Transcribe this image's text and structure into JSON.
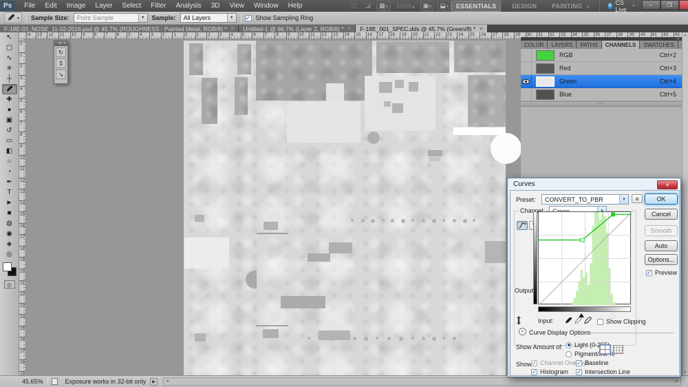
{
  "icons": {
    "close": "✕",
    "dropdown": "▼",
    "small_arrow": "▾",
    "check": "✓",
    "menu": "≡",
    "chevrons": "»",
    "right_arrow": "▶",
    "left_arrow": "◄",
    "up_arrow": "▲",
    "down_arrow": "▼"
  },
  "colors": {
    "selection_blue": "#2e7de8",
    "rgb_thumb_green": "#44d33c",
    "curve_green": "#2ec82e",
    "histogram_green": "#c5eeb1",
    "close_red": "#c93a41"
  },
  "menu_bar": {
    "logo": "Ps",
    "items": [
      "File",
      "Edit",
      "Image",
      "Layer",
      "Select",
      "Filter",
      "Analysis",
      "3D",
      "View",
      "Window",
      "Help"
    ],
    "zoom_display": "100%",
    "workspaces": [
      {
        "label": "ESSENTIALS",
        "active": true
      },
      {
        "label": "DESIGN",
        "active": false
      },
      {
        "label": "PAINTING",
        "active": false
      }
    ],
    "overflow": "»",
    "cs_live": "CS Live"
  },
  "options_bar": {
    "sample_size_label": "Sample Size:",
    "sample_size_value": "Point Sample",
    "sample_label": "Sample:",
    "sample_value": "All Layers",
    "show_sampling_ring_label": "Show Sampling Ring",
    "show_sampling_ring_checked": true
  },
  "document_tabs": [
    {
      "title": "F-18E-01_NOSE_11-02-2016.psd @ 45.7% (ROUGHNESS - Painted Metal, RGB/8) *",
      "active": false
    },
    {
      "title": "Untitled-1 @ 66.7% (Layer 2, RGB/8) *",
      "active": false
    },
    {
      "title": "F-18E_001_SPEC.dds @ 45.7% (Green/8) *",
      "active": true
    }
  ],
  "tool_palette": [
    {
      "name": "move-tool",
      "glyph": "↖",
      "selected": false
    },
    {
      "name": "marquee-tool",
      "glyph": "▢",
      "selected": false
    },
    {
      "name": "lasso-tool",
      "glyph": "∿",
      "selected": false
    },
    {
      "name": "quick-selection-tool",
      "glyph": "✳",
      "selected": false
    },
    {
      "name": "crop-tool",
      "glyph": "┼",
      "selected": false
    },
    {
      "name": "eyedropper-tool",
      "glyph": "dropper",
      "selected": true
    },
    {
      "name": "healing-brush-tool",
      "glyph": "✚",
      "selected": false
    },
    {
      "name": "brush-tool",
      "glyph": "●",
      "selected": false
    },
    {
      "name": "clone-stamp-tool",
      "glyph": "▣",
      "selected": false
    },
    {
      "name": "history-brush-tool",
      "glyph": "↺",
      "selected": false
    },
    {
      "name": "eraser-tool",
      "glyph": "▭",
      "selected": false
    },
    {
      "name": "gradient-tool",
      "glyph": "◧",
      "selected": false
    },
    {
      "name": "blur-tool",
      "glyph": "○",
      "selected": false
    },
    {
      "name": "dodge-tool",
      "glyph": "◔",
      "selected": false
    },
    {
      "name": "pen-tool",
      "glyph": "✒",
      "selected": false
    },
    {
      "name": "type-tool",
      "glyph": "T",
      "selected": false
    },
    {
      "name": "path-selection-tool",
      "glyph": "►",
      "selected": false
    },
    {
      "name": "shape-tool",
      "glyph": "■",
      "selected": false
    },
    {
      "name": "3d-object-rotate-tool",
      "glyph": "◍",
      "selected": false
    },
    {
      "name": "3d-camera-rotate-tool",
      "glyph": "◉",
      "selected": false
    },
    {
      "name": "hand-tool",
      "glyph": "◈",
      "selected": false
    },
    {
      "name": "zoom-tool",
      "glyph": "◎",
      "selected": false
    }
  ],
  "float_panel": {
    "icons": [
      {
        "name": "float-tool-1",
        "glyph": "↻"
      },
      {
        "name": "float-tool-2",
        "glyph": "⇕"
      },
      {
        "name": "float-tool-3",
        "glyph": "↘"
      }
    ]
  },
  "panels": {
    "tabs": [
      {
        "label": "COLOR",
        "active": false
      },
      {
        "label": "LAYERS",
        "active": false
      },
      {
        "label": "PATHS",
        "active": false
      },
      {
        "label": "CHANNELS",
        "active": true
      },
      {
        "label": "SWATCHES",
        "active": false
      },
      {
        "label": "STYLES",
        "active": false
      }
    ],
    "channels": [
      {
        "name": "RGB",
        "shortcut": "Ctrl+2",
        "thumb": "#44d33c",
        "selected": false,
        "eye": false
      },
      {
        "name": "Red",
        "shortcut": "Ctrl+3",
        "thumb": "#585858",
        "selected": false,
        "eye": false
      },
      {
        "name": "Green",
        "shortcut": "Ctrl+4",
        "thumb": "#e9e9e9",
        "selected": true,
        "eye": true
      },
      {
        "name": "Blue",
        "shortcut": "Ctrl+5",
        "thumb": "#515151",
        "selected": false,
        "eye": false
      }
    ]
  },
  "curves_dialog": {
    "title": "Curves",
    "preset_label": "Preset:",
    "preset_value": "CONVERT_TO_PBR",
    "channel_label": "Channel:",
    "channel_value": "Green",
    "ok_label": "OK",
    "cancel_label": "Cancel",
    "smooth_label": "Smooth",
    "auto_label": "Auto",
    "options_label": "Options...",
    "preview_label": "Preview",
    "preview_checked": true,
    "output_label": "Output:",
    "input_label": "Input:",
    "show_clipping_label": "Show Clipping",
    "show_clipping_checked": false,
    "display_options_label": "Curve Display Options",
    "show_amount_label": "Show Amount of:",
    "amount_options": [
      {
        "label": "Light  (0-255)",
        "selected": true
      },
      {
        "label": "Pigment/Ink %",
        "selected": false
      }
    ],
    "show_label": "Show:",
    "show_checkboxes": [
      {
        "label": "Channel Overlays",
        "checked": true,
        "disabled": true,
        "col": 0,
        "row": 0
      },
      {
        "label": "Baseline",
        "checked": true,
        "disabled": false,
        "col": 1,
        "row": 0
      },
      {
        "label": "Histogram",
        "checked": true,
        "disabled": false,
        "col": 0,
        "row": 1
      },
      {
        "label": "Intersection Line",
        "checked": true,
        "disabled": false,
        "col": 1,
        "row": 1
      }
    ],
    "curve": {
      "flat_output_pct": 70,
      "points_pct": [
        [
          0,
          70
        ],
        [
          47,
          70
        ],
        [
          80,
          97.5
        ],
        [
          100,
          97.5
        ]
      ],
      "handles_pct": [
        [
          47,
          70
        ],
        [
          80,
          97.5
        ]
      ],
      "black_input_slider_pct": 47,
      "white_input_slider_pct": 80,
      "input_black_value": 120,
      "input_white_value": 204
    },
    "histogram_bins_pct": [
      0,
      0,
      0,
      0,
      0,
      0,
      0,
      0,
      0,
      0,
      0,
      0,
      0,
      0,
      3,
      8,
      15,
      26,
      38,
      30,
      35,
      22,
      45,
      85,
      100,
      100,
      92,
      100,
      96,
      78,
      40,
      12,
      3,
      0,
      0,
      0,
      0,
      0,
      0,
      0
    ]
  },
  "rulers": {
    "h_numbers": [
      "14",
      "13",
      "12",
      "11",
      "10",
      "9",
      "8",
      "7",
      "6",
      "5",
      "4",
      "3",
      "2",
      "1",
      "0",
      "1",
      "2",
      "3",
      "4",
      "5",
      "6",
      "7",
      "8",
      "9",
      "10",
      "11",
      "12",
      "13",
      "14",
      "15",
      "16",
      "17",
      "18",
      "19",
      "20",
      "21",
      "22",
      "23",
      "24",
      "25",
      "26",
      "27",
      "28",
      "29",
      "30",
      "31",
      "32",
      "33",
      "34",
      "35",
      "36",
      "37",
      "38",
      "39",
      "40",
      "41",
      "42",
      "43"
    ],
    "h_zero_index": 14,
    "v_numbers": [
      "0",
      "1",
      "2",
      "3",
      "4",
      "5",
      "6",
      "7",
      "8",
      "9",
      "10",
      "11",
      "12",
      "13",
      "14",
      "15",
      "16",
      "17",
      "18",
      "19",
      "20",
      "21",
      "22",
      "23",
      "24",
      "25",
      "26",
      "27",
      "28",
      "29"
    ]
  },
  "status_bar": {
    "zoom": "45.65%",
    "message": "Exposure works in 32-bit only"
  }
}
